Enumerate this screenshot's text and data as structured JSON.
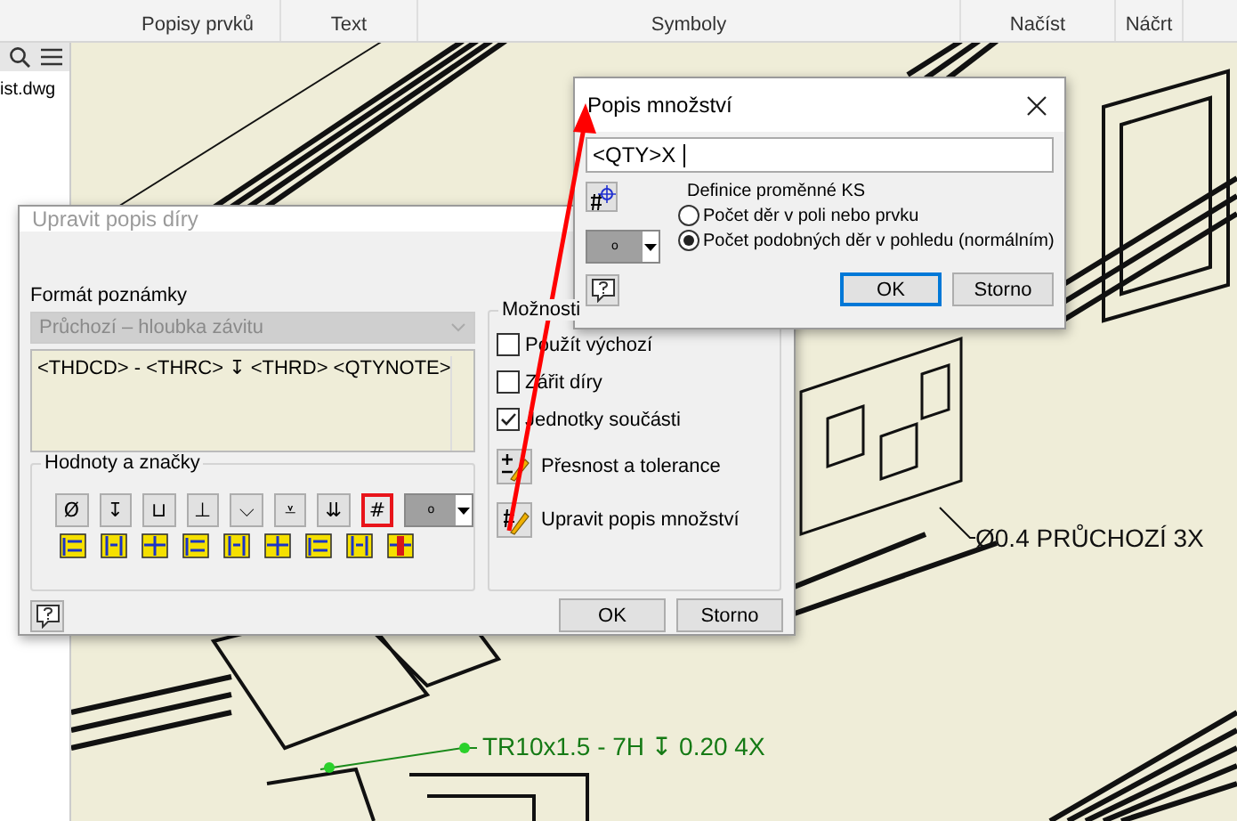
{
  "ribbon": {
    "groups": [
      {
        "label": "Popisy prvků"
      },
      {
        "label": "Text"
      },
      {
        "label": "Symboly"
      },
      {
        "label": "Načíst"
      },
      {
        "label": "Náčrt"
      }
    ]
  },
  "browser": {
    "files": [
      "ist.dwg"
    ]
  },
  "drawing": {
    "annotations": [
      {
        "kind": "plain",
        "text": "Ø0.4 PRŮCHOZÍ 3X"
      },
      {
        "kind": "selected",
        "text": "TR10x1.5 - 7H ↧ 0.20 4X"
      }
    ]
  },
  "hole_dialog": {
    "title": "Upravit popis díry",
    "active": false,
    "format_label": "Formát poznámky",
    "style_select": {
      "value": "Průchozí – hloubka závitu",
      "disabled": true
    },
    "note_text": "<THDCD> - <THRC> ↧ <THRD> <QTYNOTE>",
    "symbols_group": {
      "title": "Hodnoty a značky",
      "symbols": [
        {
          "glyph": "Ø",
          "highlighted": false
        },
        {
          "glyph": "↧",
          "highlighted": false
        },
        {
          "glyph": "⊔",
          "highlighted": false
        },
        {
          "glyph": "⊥",
          "highlighted": false
        },
        {
          "glyph": "⌵",
          "highlighted": false
        },
        {
          "glyph": "⩡",
          "highlighted": false
        },
        {
          "glyph": "⇊",
          "highlighted": false
        },
        {
          "glyph": "#",
          "highlighted": true
        }
      ],
      "color_value": "o"
    },
    "options_group": {
      "title": "Možnosti",
      "checkboxes": [
        {
          "label": "Použít výchozí",
          "checked": false
        },
        {
          "label": "Zářit díry",
          "checked": false
        },
        {
          "label": "Jednotky součásti",
          "checked": true
        }
      ],
      "actions": [
        {
          "kind": "precision",
          "label": "Přesnost a tolerance"
        },
        {
          "kind": "quantity",
          "label": "Upravit popis množství"
        }
      ]
    },
    "buttons": [
      {
        "label": "OK",
        "default": false
      },
      {
        "label": "Storno",
        "default": false
      }
    ]
  },
  "qty_dialog": {
    "title": "Popis množství",
    "active": true,
    "value": "<QTY>X",
    "section_label": "Definice proměnné KS",
    "radios": [
      {
        "label": "Počet děr v poli nebo prvku",
        "selected": false
      },
      {
        "label": "Počet podobných děr v pohledu (normálním)",
        "selected": true
      }
    ],
    "color_value": "o",
    "buttons": [
      {
        "label": "OK",
        "default": true
      },
      {
        "label": "Storno",
        "default": false
      }
    ]
  }
}
